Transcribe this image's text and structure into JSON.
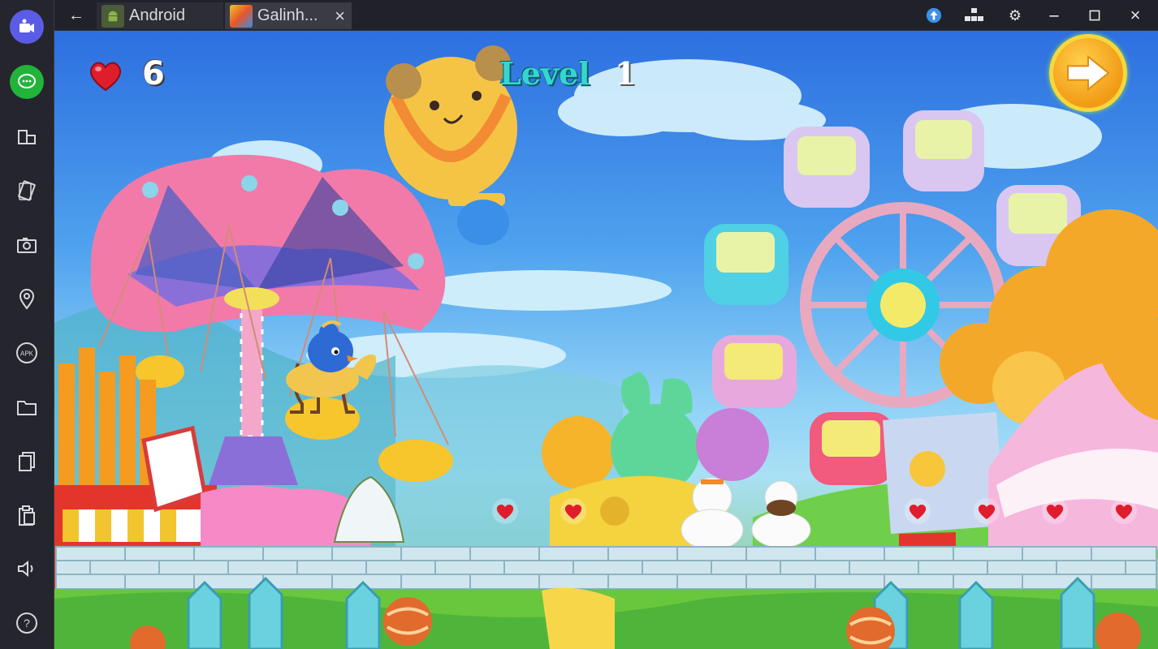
{
  "topbar": {
    "tabs": [
      {
        "label": "Android",
        "icon": "android-icon"
      },
      {
        "label": "Galinh...",
        "icon": "game-app-icon"
      }
    ],
    "controls": [
      "back-icon",
      "upload-icon",
      "multi-instance-icon",
      "gear-icon",
      "minimize-icon",
      "maximize-icon",
      "close-icon"
    ]
  },
  "sidebar": {
    "items": [
      "camera-icon",
      "chat-icon",
      "screen-rotate-icon",
      "shake-icon",
      "screenshot-icon",
      "location-icon",
      "apk-icon",
      "folder-icon",
      "copy-icon",
      "paste-icon",
      "volume-icon",
      "help-icon"
    ],
    "apk_label": "APK",
    "help_label": "?"
  },
  "game": {
    "lives": "6",
    "level_label": "Level",
    "level_number": "1"
  },
  "colors": {
    "sidebar_bg": "#24252d",
    "topbar_bg": "#202129",
    "accent_purple": "#5b5ce6",
    "accent_green": "#22b33b",
    "sky_top": "#2d6fe0",
    "heart_red": "#e01d2c",
    "next_button": "#f7a21e"
  }
}
